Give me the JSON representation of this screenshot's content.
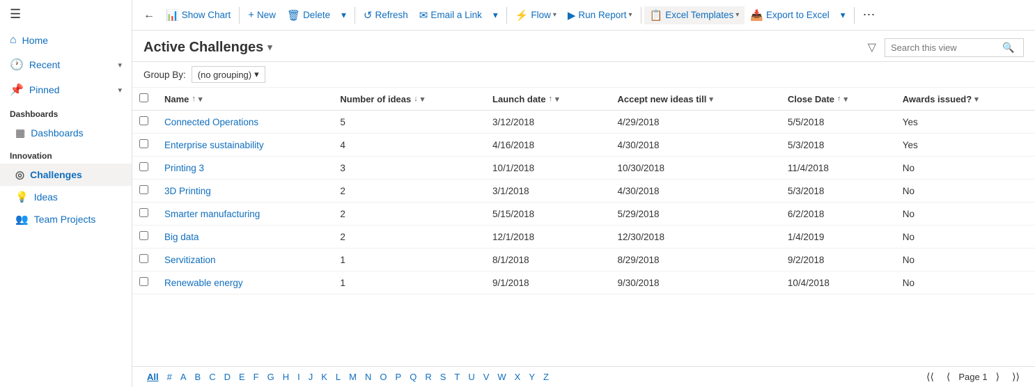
{
  "sidebar": {
    "hamburger": "☰",
    "nav_items": [
      {
        "id": "home",
        "icon": "⌂",
        "label": "Home",
        "has_chevron": false
      },
      {
        "id": "recent",
        "icon": "🕐",
        "label": "Recent",
        "has_chevron": true
      },
      {
        "id": "pinned",
        "icon": "📌",
        "label": "Pinned",
        "has_chevron": true
      }
    ],
    "sections": [
      {
        "label": "Dashboards",
        "children": [
          {
            "id": "dashboards",
            "icon": "▦",
            "label": "Dashboards"
          }
        ]
      },
      {
        "label": "Innovation",
        "children": [
          {
            "id": "challenges",
            "icon": "◎",
            "label": "Challenges",
            "active": true
          },
          {
            "id": "ideas",
            "icon": "💡",
            "label": "Ideas"
          },
          {
            "id": "team-projects",
            "icon": "👥",
            "label": "Team Projects"
          }
        ]
      }
    ]
  },
  "toolbar": {
    "back_icon": "←",
    "show_chart": "Show Chart",
    "new": "New",
    "delete": "Delete",
    "refresh": "Refresh",
    "email_link": "Email a Link",
    "flow": "Flow",
    "run_report": "Run Report",
    "excel_templates": "Excel Templates",
    "export_to_excel": "Export to Excel",
    "more_icon": "⋯"
  },
  "header": {
    "title": "Active Challenges",
    "search_placeholder": "Search this view",
    "filter_icon": "▼"
  },
  "groupby": {
    "label": "Group By:",
    "value": "(no grouping)"
  },
  "columns": [
    {
      "id": "name",
      "label": "Name",
      "sort": "asc",
      "has_filter": true
    },
    {
      "id": "num_ideas",
      "label": "Number of ideas",
      "sort": "desc",
      "has_filter": true
    },
    {
      "id": "launch_date",
      "label": "Launch date",
      "sort": "asc",
      "has_filter": true
    },
    {
      "id": "accept_till",
      "label": "Accept new ideas till",
      "sort": null,
      "has_filter": true
    },
    {
      "id": "close_date",
      "label": "Close Date",
      "sort": "asc",
      "has_filter": true
    },
    {
      "id": "awards_issued",
      "label": "Awards issued?",
      "sort": null,
      "has_filter": true
    }
  ],
  "rows": [
    {
      "name": "Connected Operations",
      "num_ideas": 5,
      "launch_date": "3/12/2018",
      "accept_till": "4/29/2018",
      "close_date": "5/5/2018",
      "awards_issued": "Yes",
      "launch_orange": false,
      "close_orange": false,
      "accept_orange": false
    },
    {
      "name": "Enterprise sustainability",
      "num_ideas": 4,
      "launch_date": "4/16/2018",
      "accept_till": "4/30/2018",
      "close_date": "5/3/2018",
      "awards_issued": "Yes",
      "launch_orange": false,
      "close_orange": false,
      "accept_orange": false
    },
    {
      "name": "Printing 3",
      "num_ideas": 3,
      "launch_date": "10/1/2018",
      "accept_till": "10/30/2018",
      "close_date": "11/4/2018",
      "awards_issued": "No",
      "launch_orange": true,
      "close_orange": true,
      "accept_orange": false
    },
    {
      "name": "3D Printing",
      "num_ideas": 2,
      "launch_date": "3/1/2018",
      "accept_till": "4/30/2018",
      "close_date": "5/3/2018",
      "awards_issued": "No",
      "launch_orange": false,
      "close_orange": false,
      "accept_orange": false
    },
    {
      "name": "Smarter manufacturing",
      "num_ideas": 2,
      "launch_date": "5/15/2018",
      "accept_till": "5/29/2018",
      "close_date": "6/2/2018",
      "awards_issued": "No",
      "launch_orange": false,
      "close_orange": false,
      "accept_orange": false
    },
    {
      "name": "Big data",
      "num_ideas": 2,
      "launch_date": "12/1/2018",
      "accept_till": "12/30/2018",
      "close_date": "1/4/2019",
      "awards_issued": "No",
      "launch_orange": false,
      "close_orange": true,
      "accept_orange": false
    },
    {
      "name": "Servitization",
      "num_ideas": 1,
      "launch_date": "8/1/2018",
      "accept_till": "8/29/2018",
      "close_date": "9/2/2018",
      "awards_issued": "No",
      "launch_orange": false,
      "close_orange": false,
      "accept_orange": false
    },
    {
      "name": "Renewable energy",
      "num_ideas": 1,
      "launch_date": "9/1/2018",
      "accept_till": "9/30/2018",
      "close_date": "10/4/2018",
      "awards_issued": "No",
      "launch_orange": false,
      "close_orange": true,
      "accept_orange": false
    }
  ],
  "footer": {
    "alpha": [
      "All",
      "#",
      "A",
      "B",
      "C",
      "D",
      "E",
      "F",
      "G",
      "H",
      "I",
      "J",
      "K",
      "L",
      "M",
      "N",
      "O",
      "P",
      "Q",
      "R",
      "S",
      "T",
      "U",
      "V",
      "W",
      "X",
      "Y",
      "Z"
    ],
    "active_alpha": "All",
    "page_label": "Page 1",
    "first_icon": "⟨⟨",
    "prev_icon": "⟨",
    "next_icon": "⟩",
    "last_icon": "⟩⟩"
  }
}
